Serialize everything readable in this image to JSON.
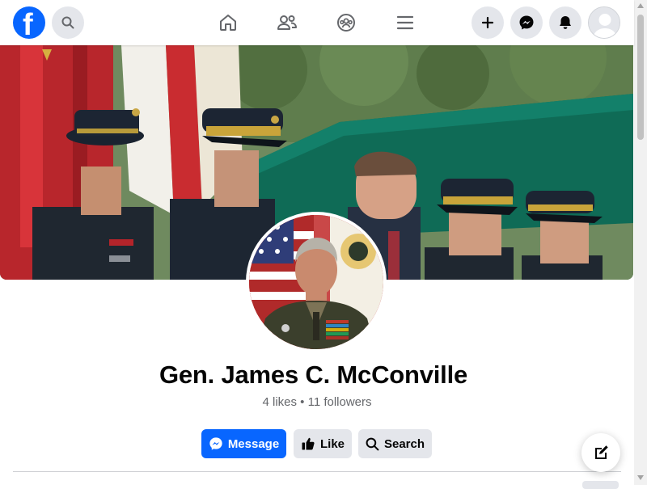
{
  "header": {
    "logo_letter": "f",
    "logo_icon": "facebook-logo",
    "search_icon": "search-icon",
    "nav": [
      {
        "name": "home",
        "icon": "home-icon"
      },
      {
        "name": "friends",
        "icon": "friends-icon"
      },
      {
        "name": "groups",
        "icon": "groups-icon"
      },
      {
        "name": "menu",
        "icon": "hamburger-menu-icon"
      }
    ],
    "actions": [
      {
        "name": "create",
        "icon": "plus-icon"
      },
      {
        "name": "messenger",
        "icon": "messenger-icon"
      },
      {
        "name": "notifications",
        "icon": "bell-icon"
      },
      {
        "name": "account",
        "icon": "avatar-placeholder"
      }
    ]
  },
  "cover": {
    "icon": "cover-photo"
  },
  "profile": {
    "name": "Gen. James C. McConville",
    "stats": "4 likes • 11 followers",
    "photo": "profile-photo"
  },
  "actions": {
    "message_label": "Message",
    "like_label": "Like",
    "search_label": "Search"
  },
  "colors": {
    "brand": "#0866ff",
    "button_gray": "#e4e6eb",
    "text_primary": "#050505",
    "text_secondary": "#65676b"
  },
  "floating": {
    "compose_icon": "compose-icon"
  }
}
